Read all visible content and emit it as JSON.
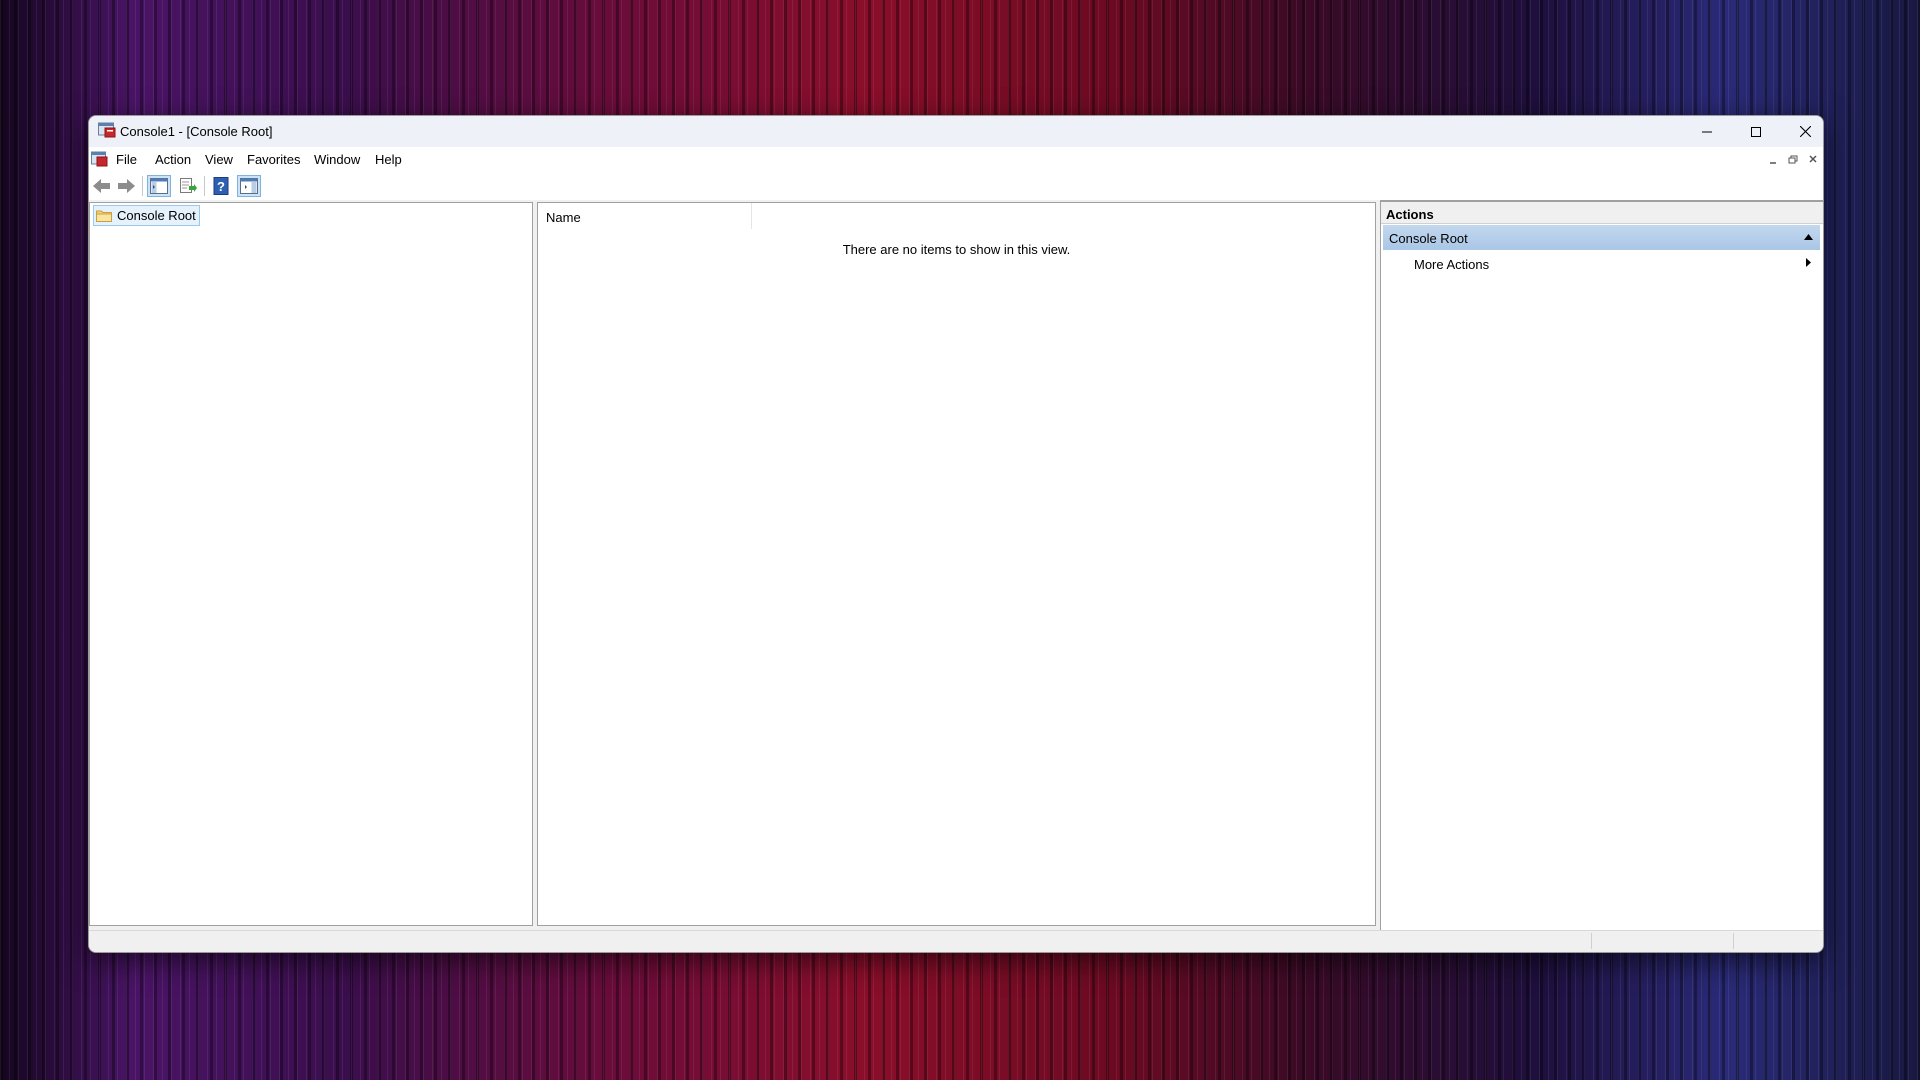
{
  "window": {
    "title": "Console1 - [Console Root]"
  },
  "menubar": {
    "items": [
      "File",
      "Action",
      "View",
      "Favorites",
      "Window",
      "Help"
    ]
  },
  "toolbar": {
    "buttons": [
      "back-icon",
      "forward-icon",
      "show-hide-console-tree-icon",
      "export-list-icon",
      "help-icon",
      "show-hide-action-pane-icon"
    ]
  },
  "tree": {
    "root_label": "Console Root"
  },
  "list": {
    "column_name": "Name",
    "empty_message": "There are no items to show in this view."
  },
  "actions": {
    "header": "Actions",
    "section_title": "Console Root",
    "items": [
      "More Actions"
    ]
  },
  "colors": {
    "selection_bg": "#e5f1fb",
    "section_bg": "#b7cfea",
    "titlebar_bg": "#eef2f8"
  }
}
